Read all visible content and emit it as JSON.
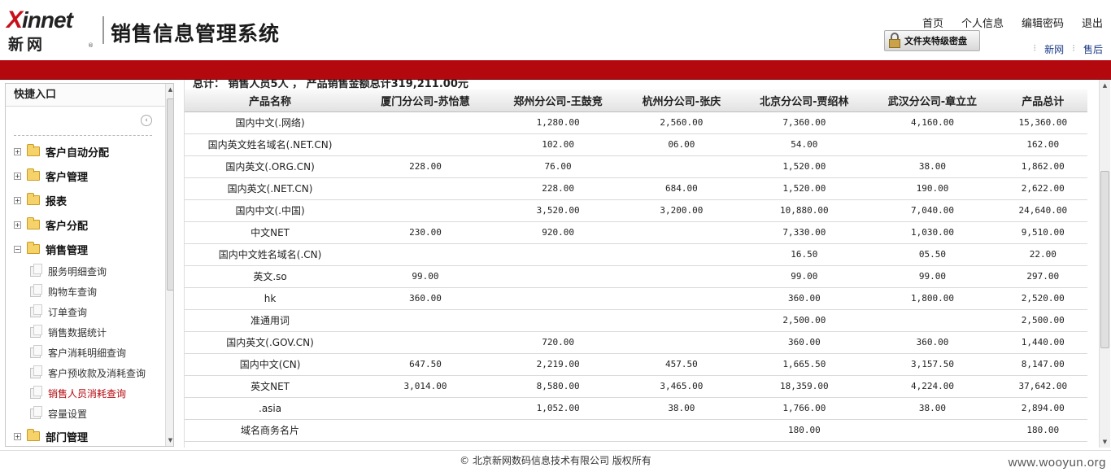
{
  "header": {
    "logo_en_x": "X",
    "logo_en_rest": "innet",
    "logo_cn": "新网",
    "logo_reg": "®",
    "system_title": "销售信息管理系统",
    "nav": [
      "首页",
      "个人信息",
      "编辑密码",
      "退出"
    ],
    "badge_text": "文件夹特级密盘",
    "sub_nav": [
      "新网",
      "售后"
    ]
  },
  "sidebar": {
    "title": "快捷入口",
    "groups": [
      {
        "label": "客户自动分配",
        "expanded": false
      },
      {
        "label": "客户管理",
        "expanded": false
      },
      {
        "label": "报表",
        "expanded": false
      },
      {
        "label": "客户分配",
        "expanded": false
      },
      {
        "label": "销售管理",
        "expanded": true,
        "items": [
          "服务明细查询",
          "购物车查询",
          "订单查询",
          "销售数据统计",
          "客户消耗明细查询",
          "客户预收款及消耗查询",
          "销售人员消耗查询",
          "容量设置"
        ]
      },
      {
        "label": "部门管理",
        "expanded": false
      }
    ],
    "active_item": "销售人员消耗查询"
  },
  "main": {
    "summary": "总计：  销售人员5人  ，  产品销售金额总计319,211.00元",
    "columns": [
      "产品名称",
      "厦门分公司-苏怡慧",
      "郑州分公司-王鼓竞",
      "杭州分公司-张庆",
      "北京分公司-贾绍林",
      "武汉分公司-章立立",
      "产品总计"
    ],
    "rows": [
      [
        "国内中文(.网络)",
        "",
        "1,280.00",
        "2,560.00",
        "7,360.00",
        "4,160.00",
        "15,360.00"
      ],
      [
        "国内英文姓名域名(.NET.CN)",
        "",
        "102.00",
        "06.00",
        "54.00",
        "",
        "162.00"
      ],
      [
        "国内英文(.ORG.CN)",
        "228.00",
        "76.00",
        "",
        "1,520.00",
        "38.00",
        "1,862.00"
      ],
      [
        "国内英文(.NET.CN)",
        "",
        "228.00",
        "684.00",
        "1,520.00",
        "190.00",
        "2,622.00"
      ],
      [
        "国内中文(.中国)",
        "",
        "3,520.00",
        "3,200.00",
        "10,880.00",
        "7,040.00",
        "24,640.00"
      ],
      [
        "中文NET",
        "230.00",
        "920.00",
        "",
        "7,330.00",
        "1,030.00",
        "9,510.00"
      ],
      [
        "国内中文姓名域名(.CN)",
        "",
        "",
        "",
        "16.50",
        "05.50",
        "22.00"
      ],
      [
        "英文.so",
        "99.00",
        "",
        "",
        "99.00",
        "99.00",
        "297.00"
      ],
      [
        "hk",
        "360.00",
        "",
        "",
        "360.00",
        "1,800.00",
        "2,520.00"
      ],
      [
        "准通用词",
        "",
        "",
        "",
        "2,500.00",
        "",
        "2,500.00"
      ],
      [
        "国内英文(.GOV.CN)",
        "",
        "720.00",
        "",
        "360.00",
        "360.00",
        "1,440.00"
      ],
      [
        "国内中文(CN)",
        "647.50",
        "2,219.00",
        "457.50",
        "1,665.50",
        "3,157.50",
        "8,147.00"
      ],
      [
        "英文NET",
        "3,014.00",
        "8,580.00",
        "3,465.00",
        "18,359.00",
        "4,224.00",
        "37,642.00"
      ],
      [
        ".asia",
        "",
        "1,052.00",
        "38.00",
        "1,766.00",
        "38.00",
        "2,894.00"
      ],
      [
        "域名商务名片",
        "",
        "",
        "",
        "180.00",
        "",
        "180.00"
      ]
    ]
  },
  "footer": {
    "copyright": "© 北京新网数码信息技术有限公司   版权所有",
    "watermark": "www.wooyun.org"
  }
}
